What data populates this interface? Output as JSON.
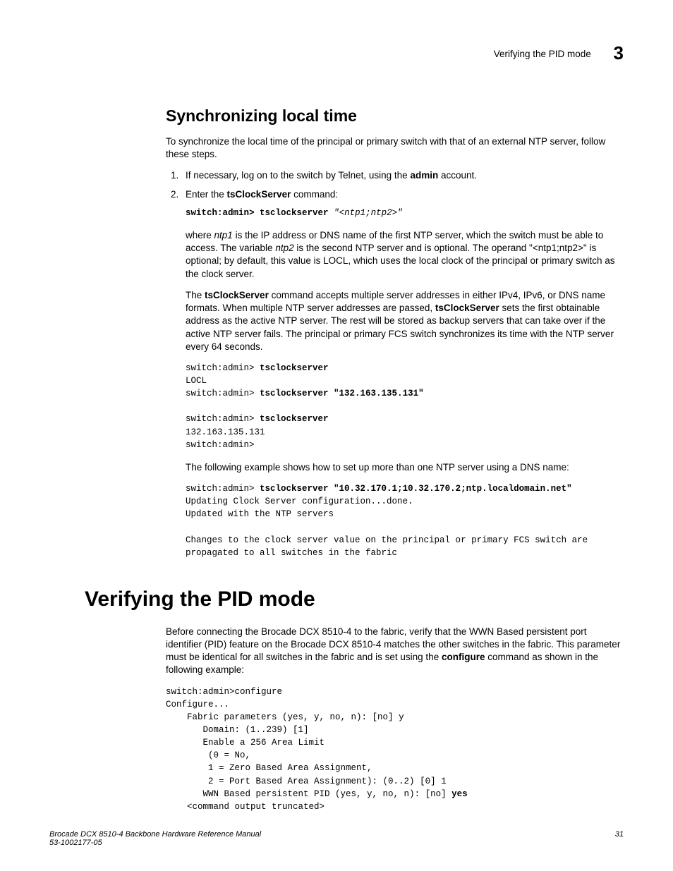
{
  "header": {
    "running_title": "Verifying the PID mode",
    "chapter_number": "3"
  },
  "section1": {
    "heading": "Synchronizing local time",
    "intro": "To synchronize the local time of the principal or primary switch with that of an external NTP server, follow these steps.",
    "step1_pre": "If necessary, log on to the switch by Telnet, using the ",
    "step1_bold": "admin",
    "step1_post": " account.",
    "step2_pre": "Enter the ",
    "step2_bold": "tsClockServer",
    "step2_post": " command:",
    "cmd1_prompt": "switch:admin> ",
    "cmd1_cmd": "tsclockserver",
    "cmd1_arg": " \"<ntp1;ntp2>\"",
    "para_ntp_1": "where ",
    "para_ntp_i1": "ntp1",
    "para_ntp_2": " is the IP address or DNS name of the first NTP server, which the switch must be able to access. The variable ",
    "para_ntp_i2": "ntp2",
    "para_ntp_3": " is the second NTP server and is optional. The operand \"<ntp1;ntp2>\" is optional; by default, this value is LOCL, which uses the local clock of the principal or primary switch as the clock server.",
    "para_ts_pre": "The ",
    "para_ts_b1": "tsClockServer",
    "para_ts_mid": " command accepts multiple server addresses in either IPv4, IPv6, or DNS name formats. When multiple NTP server addresses are passed, ",
    "para_ts_b2": "tsClockServer",
    "para_ts_post": " sets the first obtainable address as the active NTP server. The rest will be stored as backup servers that can take over if the active NTP server fails. The principal or primary FCS switch synchronizes its time with the NTP server every 64 seconds.",
    "block1_l1_p": "switch:admin> ",
    "block1_l1_c": "tsclockserver",
    "block1_l2": "LOCL",
    "block1_l3_p": "switch:admin> ",
    "block1_l3_c": "tsclockserver \"132.163.135.131\"",
    "block1_l4_p": "switch:admin> ",
    "block1_l4_c": "tsclockserver",
    "block1_l5": "132.163.135.131",
    "block1_l6": "switch:admin>",
    "para_dns": "The following example shows how to set up more than one NTP server using a DNS name:",
    "block2_l1_p": "switch:admin> ",
    "block2_l1_c": "tsclockserver \"10.32.170.1;10.32.170.2;ntp.localdomain.net\"",
    "block2_l2": "Updating Clock Server configuration...done.",
    "block2_l3": "Updated with the NTP servers",
    "block2_l4": "Changes to the clock server value on the principal or primary FCS switch are propagated to all switches in the fabric"
  },
  "section2": {
    "heading": "Verifying the PID mode",
    "para_pre": "Before connecting the Brocade DCX 8510-4 to the fabric, verify that the WWN Based persistent port identifier (PID) feature on the Brocade DCX 8510-4 matches the other switches in the fabric. This parameter must be identical for all switches in the fabric and is set using the ",
    "para_bold": "configure",
    "para_post": " command as shown in the following example:",
    "code_l1": "switch:admin>configure",
    "code_l2": "Configure...",
    "code_l3": "    Fabric parameters (yes, y, no, n): [no] y",
    "code_l4": "       Domain: (1..239) [1]",
    "code_l5": "       Enable a 256 Area Limit",
    "code_l6": "        (0 = No,",
    "code_l7": "        1 = Zero Based Area Assignment,",
    "code_l8": "        2 = Port Based Area Assignment): (0..2) [0] 1",
    "code_l9_pre": "       WWN Based persistent PID (yes, y, no, n): [no] ",
    "code_l9_b": "yes",
    "code_l10": "    <command output truncated>"
  },
  "footer": {
    "title": "Brocade DCX 8510-4 Backbone Hardware Reference Manual",
    "docnum": "53-1002177-05",
    "page": "31"
  }
}
